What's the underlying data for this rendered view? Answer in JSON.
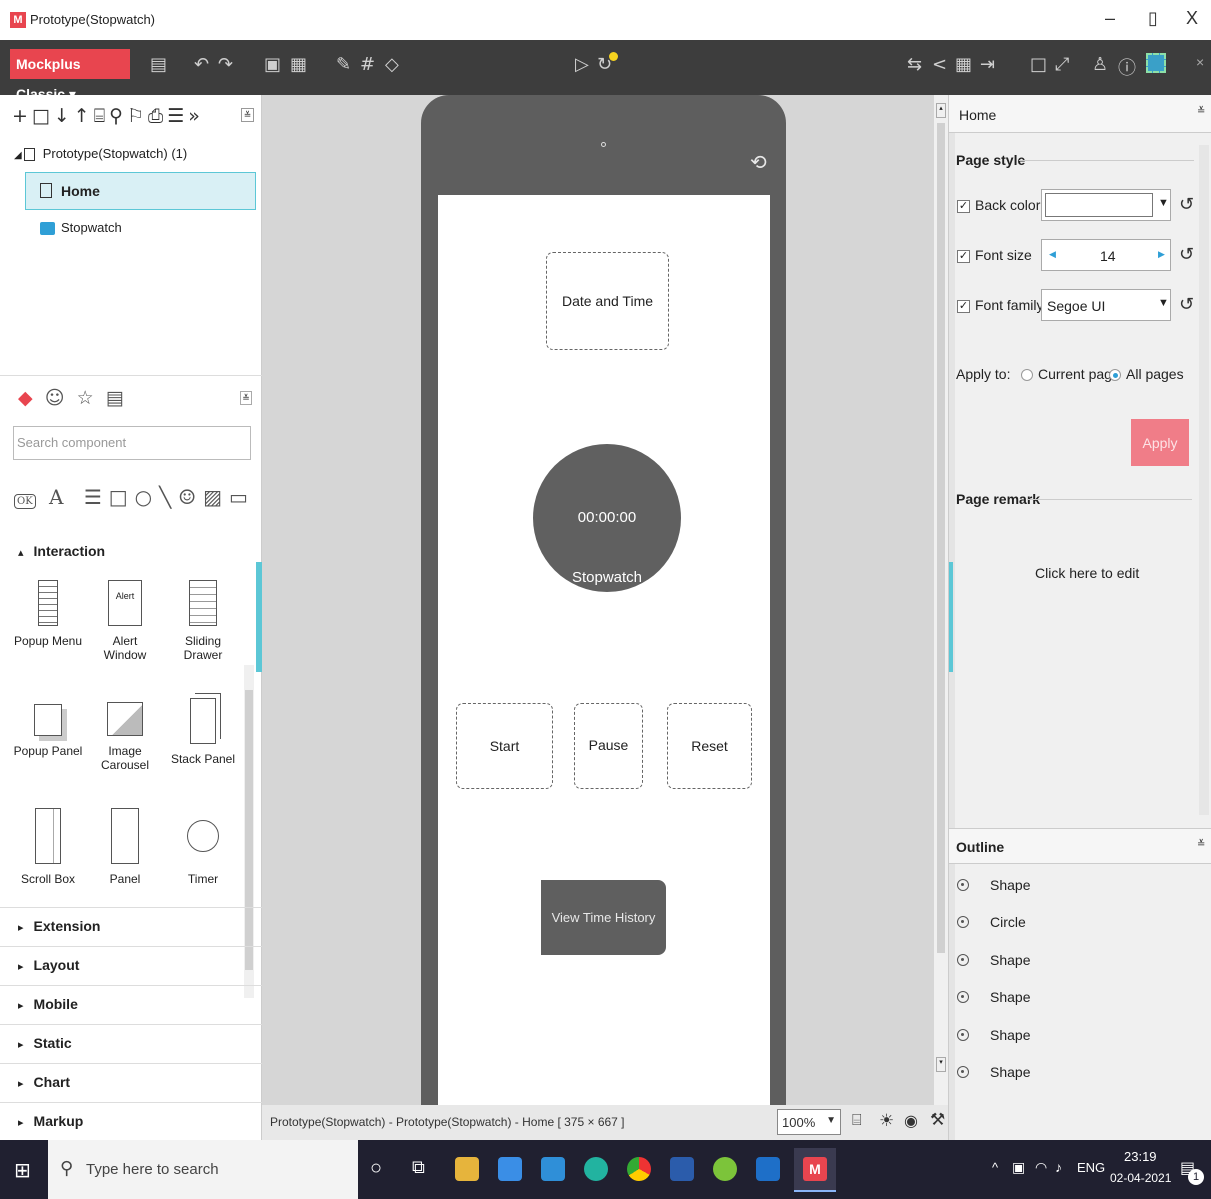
{
  "window": {
    "title": "Prototype(Stopwatch)",
    "app_icon_letter": "M",
    "minimize": "–",
    "restore": "▯",
    "close": "X"
  },
  "toolbar": {
    "brand": "Mockplus Classic ▾",
    "close_mark": "×"
  },
  "project_tree": {
    "root": "Prototype(Stopwatch) (1)",
    "items": [
      {
        "label": "Home",
        "selected": true
      },
      {
        "label": "Stopwatch",
        "selected": false
      }
    ]
  },
  "components": {
    "search_placeholder": "Search component",
    "interaction_section": "Interaction",
    "items": [
      {
        "label": "Popup Menu",
        "icon": "popup-menu-icon"
      },
      {
        "label": "Alert Window",
        "icon": "alert-window-icon",
        "icon_text": "Alert"
      },
      {
        "label": "Sliding Drawer",
        "icon": "sliding-drawer-icon"
      },
      {
        "label": "Popup Panel",
        "icon": "popup-panel-icon"
      },
      {
        "label": "Image Carousel",
        "icon": "image-carousel-icon"
      },
      {
        "label": "Stack Panel",
        "icon": "stack-panel-icon"
      },
      {
        "label": "Scroll Box",
        "icon": "scroll-box-icon"
      },
      {
        "label": "Panel",
        "icon": "panel-icon"
      },
      {
        "label": "Timer",
        "icon": "timer-icon"
      }
    ],
    "sections": [
      "Extension",
      "Layout",
      "Mobile",
      "Static",
      "Chart",
      "Markup"
    ]
  },
  "canvas": {
    "date_time": "Date and Time",
    "timer_value": "00:00:00",
    "timer_label": "Stopwatch",
    "start": "Start",
    "pause": "Pause",
    "reset": "Reset",
    "view_history": "View Time History"
  },
  "statusbar": {
    "path": "Prototype(Stopwatch) - Prototype(Stopwatch) - Home [ 375 × 667 ]",
    "zoom": "100%"
  },
  "properties": {
    "header": "Home",
    "page_style": "Page style",
    "back_color_label": "Back color",
    "back_color_value": "#FFFFFF",
    "font_size_label": "Font size",
    "font_size_value": "14",
    "font_family_label": "Font family",
    "font_family_value": "Segoe UI",
    "apply_to_label": "Apply to:",
    "apply_current": "Current page",
    "apply_all": "All pages",
    "apply_button": "Apply",
    "page_remark": "Page remark",
    "remark_placeholder": "Click here to edit"
  },
  "outline": {
    "title": "Outline",
    "items": [
      "Shape",
      "Circle",
      "Shape",
      "Shape",
      "Shape",
      "Shape"
    ]
  },
  "taskbar": {
    "search_placeholder": "Type here to search",
    "lang": "ENG",
    "time": "23:19",
    "date": "02-04-2021",
    "notifications": "1"
  },
  "colors": {
    "brand": "#e8454f",
    "selection": "#d9f0f5",
    "accent": "#5cc7d6",
    "apply_button": "#f07d88"
  }
}
